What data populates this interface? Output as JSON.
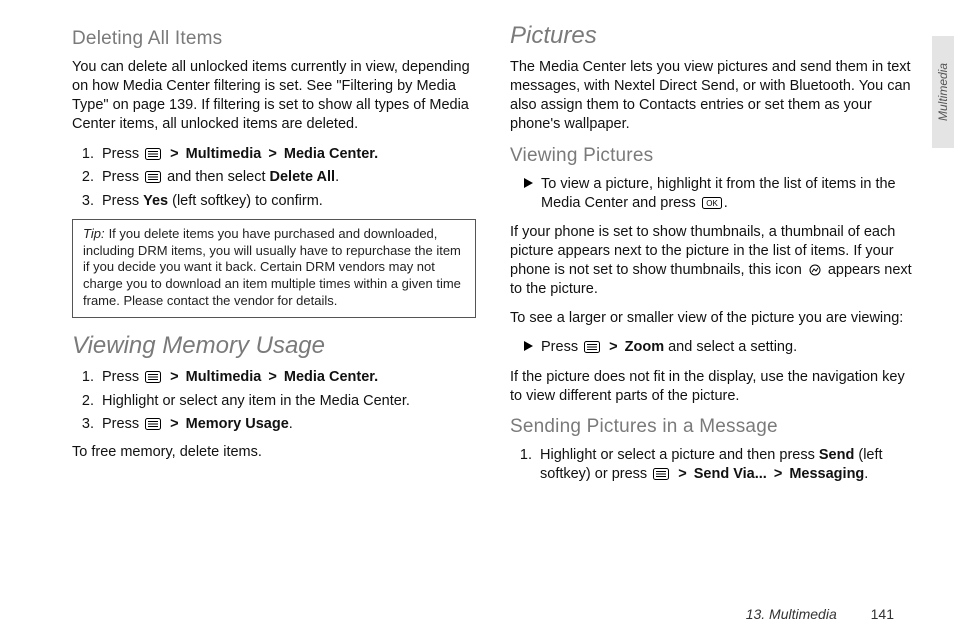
{
  "sideTab": "Multimedia",
  "footer": {
    "chapter": "13. Multimedia",
    "page": "141"
  },
  "left": {
    "deleting": {
      "heading": "Deleting All Items",
      "intro": "You can delete all unlocked items currently in view, depending on how Media Center filtering is set. See \"Filtering by Media Type\" on page 139. If filtering is set to show all types of Media Center items, all unlocked items are deleted.",
      "step1_a": "Press ",
      "step1_b": "Multimedia",
      "step1_c": "Media Center.",
      "step2_a": "Press ",
      "step2_b": " and then select ",
      "step2_c": "Delete All",
      "step2_d": ".",
      "step3_a": "Press ",
      "step3_b": "Yes",
      "step3_c": " (left softkey) to confirm.",
      "tip_label": "Tip:",
      "tip_body": "If you delete items you have purchased and downloaded, including DRM items, you will usually have to repurchase the item if you decide you want it back. Certain DRM vendors may not charge you to download an item multiple times within a given time frame. Please contact the vendor for details."
    },
    "memory": {
      "heading": "Viewing Memory Usage",
      "step1_a": "Press ",
      "step1_b": "Multimedia",
      "step1_c": "Media Center.",
      "step2": "Highlight or select any item in the Media Center.",
      "step3_a": "Press ",
      "step3_b": "Memory Usage",
      "step3_c": ".",
      "outro": "To free memory, delete items."
    }
  },
  "right": {
    "pictures": {
      "heading": "Pictures",
      "intro": "The Media Center lets you view pictures and send them in text messages, with Nextel Direct Send, or with Bluetooth. You can also assign them to Contacts entries or set them as your phone's wallpaper."
    },
    "viewing": {
      "heading": "Viewing Pictures",
      "bullet_a": "To view a picture, highlight it from the list of items in the Media Center and press ",
      "bullet_b": ".",
      "para1_a": "If your phone is set to show thumbnails, a thumbnail of each picture appears next to the picture in the list of items. If your phone is not set to show thumbnails, this icon ",
      "para1_b": " appears next to the picture.",
      "para2": "To see a larger or smaller view of the picture you are viewing:",
      "zoom_a": "Press ",
      "zoom_b": "Zoom",
      "zoom_c": " and select a setting.",
      "para3": "If the picture does not fit in the display, use the navigation key to view different parts of the picture."
    },
    "sending": {
      "heading": "Sending Pictures in a Message",
      "step1_a": "Highlight or select a picture and then press ",
      "step1_b": "Send",
      "step1_c": " (left softkey) or press ",
      "step1_d": "Send Via...",
      "step1_e": "Messaging",
      "step1_f": "."
    }
  }
}
